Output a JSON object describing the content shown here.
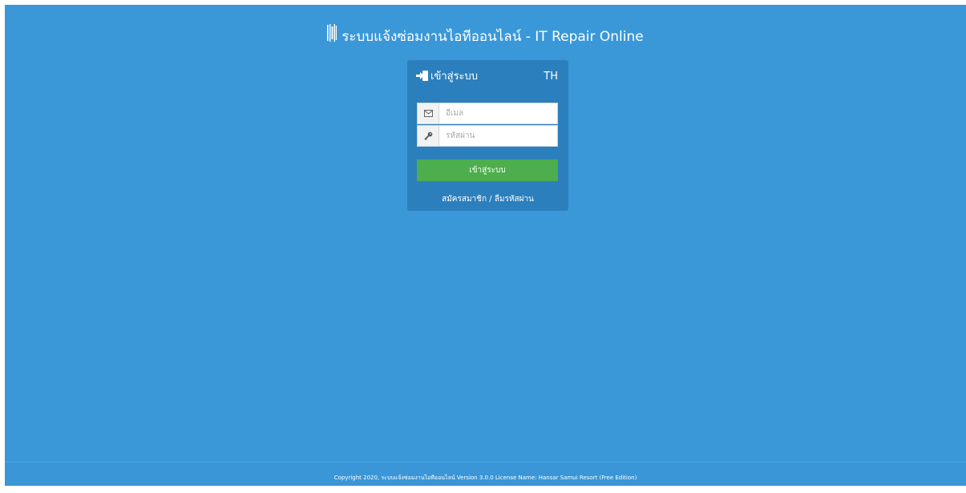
{
  "header": {
    "title": "ระบบแจ้งซ่อมงานไอทีออนไลน์ - IT Repair Online",
    "logo_icon": "barcode-logo-icon"
  },
  "login_box": {
    "title": "เข้าสู่ระบบ",
    "title_icon": "sign-in-icon",
    "language": "TH",
    "email": {
      "placeholder": "อีเมล",
      "value": "",
      "icon": "envelope-icon"
    },
    "password": {
      "placeholder": "รหัสผ่าน",
      "value": "",
      "icon": "key-icon"
    },
    "submit_label": "เข้าสู่ระบบ",
    "register_link": "สมัครสมาชิก",
    "separator": "/",
    "forgot_link": "ลืมรหัสผ่าน"
  },
  "footer": {
    "text": "Copyright 2020, ระบบแจ้งซ่อมงานไอทีออนไลน์ Version 3.0.0 License Name: Hansar Samui Resort (Free Edition)"
  },
  "colors": {
    "background": "#3a98d9",
    "panel": "#2c7fbd",
    "button": "#4cae4c",
    "text": "#ffffff"
  }
}
